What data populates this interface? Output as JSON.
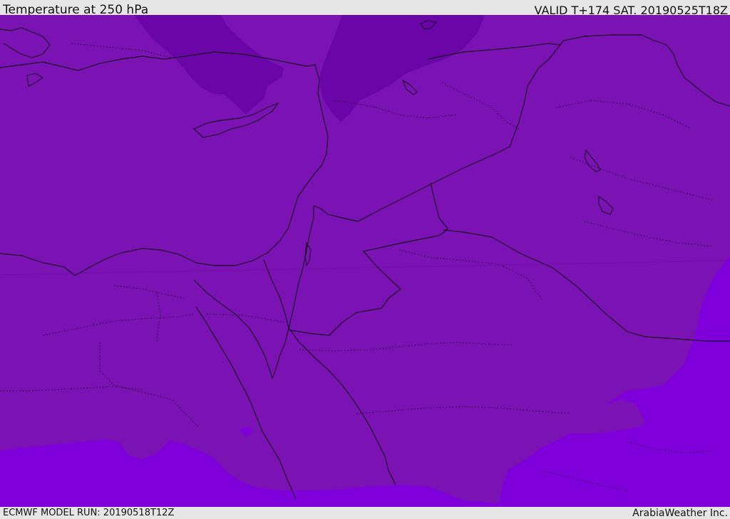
{
  "header": {
    "title": "Temperature at 250 hPa",
    "valid_time": "VALID T+174 SAT. 20190525T18Z"
  },
  "footer": {
    "model_run": "ECMWF MODEL RUN: 20190518T12Z",
    "credit": "ArabiaWeather Inc."
  },
  "colors": {
    "band_cold": "#6a06a8",
    "band_mid": "#7a12b4",
    "band_warm": "#8000dc",
    "coastline": "#000000",
    "background": "#e6e6e6"
  }
}
